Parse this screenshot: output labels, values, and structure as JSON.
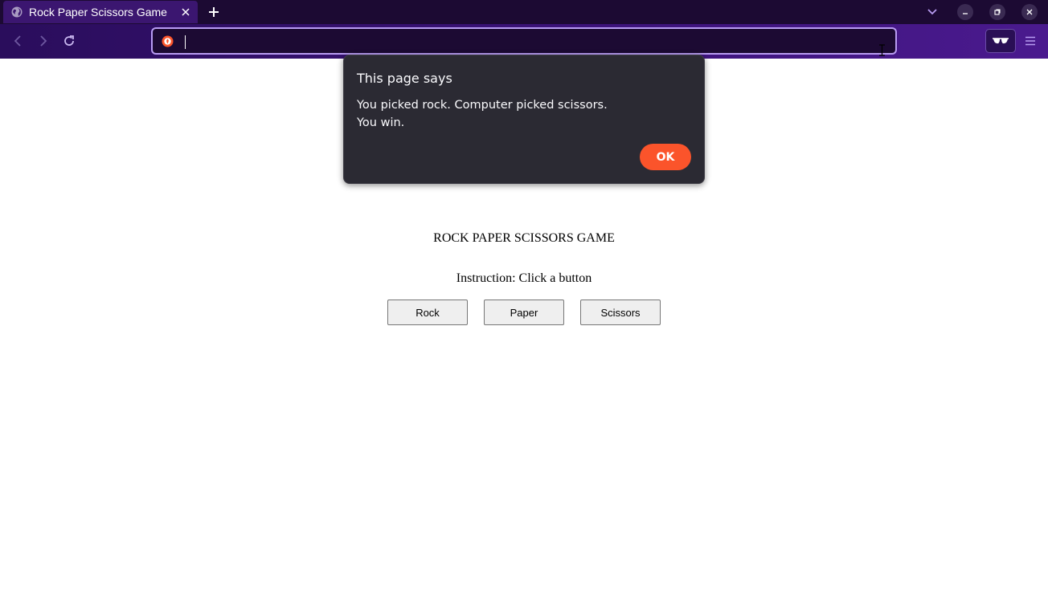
{
  "browser": {
    "tab_title": "Rock Paper Scissors Game",
    "url_value": "",
    "accent_color": "#b89cf2"
  },
  "page": {
    "title": "ROCK PAPER SCISSORS GAME",
    "instruction": "Instruction: Click a button",
    "buttons": {
      "rock": "Rock",
      "paper": "Paper",
      "scissors": "Scissors"
    }
  },
  "dialog": {
    "title": "This page says",
    "message_line1": "You picked rock. Computer picked scissors.",
    "message_line2": "You win.",
    "ok_label": "OK",
    "ok_color": "#fb542b"
  }
}
